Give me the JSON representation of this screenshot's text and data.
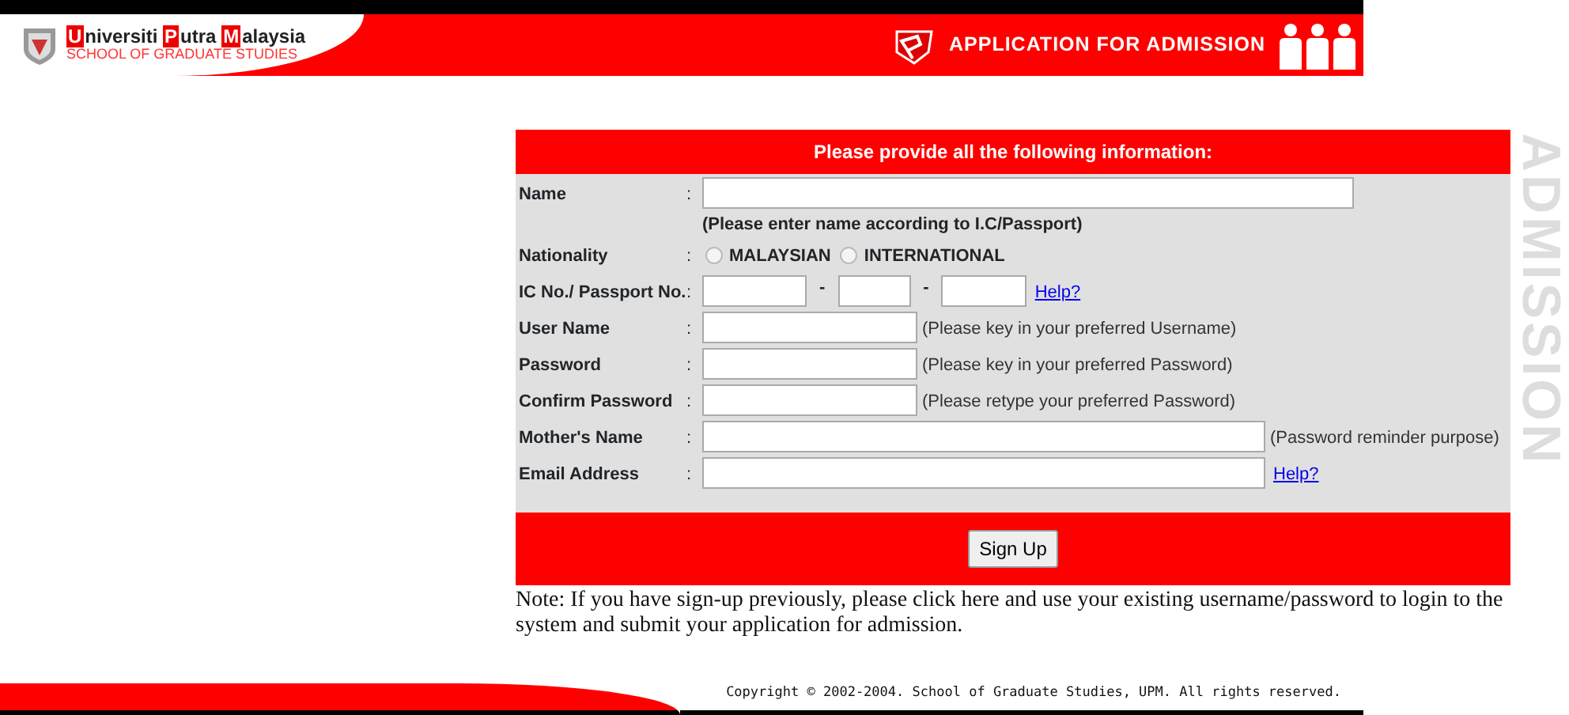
{
  "header": {
    "logo": {
      "words": [
        {
          "initial": "U",
          "rest": "niversiti"
        },
        {
          "initial": "P",
          "rest": "utra"
        },
        {
          "initial": "M",
          "rest": "alaysia"
        }
      ],
      "subtitle": "SCHOOL OF GRADUATE STUDIES"
    },
    "banner_title": "APPLICATION FOR ADMISSION"
  },
  "form": {
    "heading": "Please provide all the following information:",
    "fields": [
      {
        "kind": "name",
        "label": "Name",
        "colon": ":",
        "note": "(Please enter name according to I.C/Passport)"
      },
      {
        "kind": "radio",
        "label": "Nationality",
        "colon": ":",
        "options": [
          {
            "label": "MALAYSIAN",
            "selected": false
          },
          {
            "label": "INTERNATIONAL",
            "selected": false
          }
        ]
      },
      {
        "kind": "ic",
        "label": "IC No./ Passport No.",
        "colon": ":",
        "separators": [
          "-",
          "-"
        ],
        "link": "Help?"
      },
      {
        "kind": "short",
        "label": "User Name",
        "colon": ":",
        "note": "(Please key in your preferred Username)"
      },
      {
        "kind": "short",
        "label": "Password",
        "colon": ":",
        "note": "(Please key in your preferred Password)"
      },
      {
        "kind": "short",
        "label": "Confirm Password",
        "colon": ":",
        "note": "(Please retype your preferred Password)"
      },
      {
        "kind": "wide",
        "label": "Mother's Name",
        "colon": ":",
        "note": "(Password reminder purpose)"
      },
      {
        "kind": "wide",
        "label": "Email Address",
        "colon": ":",
        "link": "Help?"
      }
    ],
    "submit": "Sign Up"
  },
  "note": "Note: If you have sign-up previously, please click here and use your existing username/password to login to the system and submit your application for admission.",
  "side_title": "ADMISSION",
  "footer": {
    "copyright": "Copyright © 2002-2004. School of Graduate Studies, UPM. All rights reserved."
  }
}
